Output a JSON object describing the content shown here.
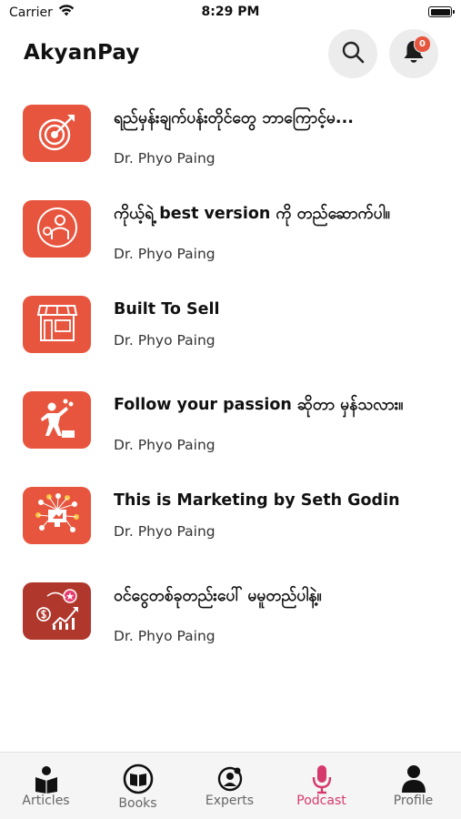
{
  "status_bar": {
    "carrier": "Carrier",
    "time": "8:29 PM"
  },
  "header": {
    "title": "AkyanPay",
    "notification_count": "0"
  },
  "podcasts": [
    {
      "title": "ရည်မှန်းချက်ပန်းတိုင်တွေ ဘာကြောင့်မ...",
      "author": "Dr. Phyo Paing",
      "icon": "target-icon"
    },
    {
      "title": "ကိုယ့်ရဲ့ best version ကို တည်ဆောက်ပါ။",
      "author": "Dr. Phyo Paing",
      "icon": "businessman-icon"
    },
    {
      "title": "Built To Sell",
      "author": "Dr. Phyo Paing",
      "icon": "storefront-icon"
    },
    {
      "title": "Follow your passion ဆိုတာ မှန်သလား။",
      "author": "Dr. Phyo Paing",
      "icon": "person-juggling-icon"
    },
    {
      "title": "This is Marketing by Seth Godin",
      "author": "Dr. Phyo Paing",
      "icon": "marketing-network-icon"
    },
    {
      "title": "ဝင်ငွေတစ်ခုတည်းပေါ် မမူတည်ပါနဲ့။",
      "author": "Dr. Phyo Paing",
      "icon": "income-growth-icon"
    }
  ],
  "tabs": [
    {
      "label": "Articles",
      "icon": "reader-icon",
      "active": false
    },
    {
      "label": "Books",
      "icon": "book-icon",
      "active": false
    },
    {
      "label": "Experts",
      "icon": "expert-icon",
      "active": false
    },
    {
      "label": "Podcast",
      "icon": "microphone-icon",
      "active": true
    },
    {
      "label": "Profile",
      "icon": "person-icon",
      "active": false
    }
  ],
  "colors": {
    "accent": "#e8553e",
    "accent_dark": "#b0372c",
    "tab_active": "#d63a6c",
    "tab_inactive": "#666666"
  }
}
